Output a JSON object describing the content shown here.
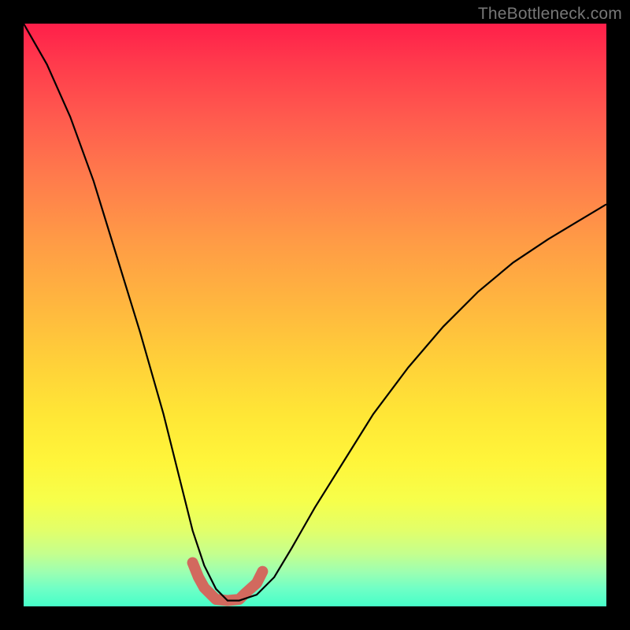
{
  "watermark": {
    "text": "TheBottleneck.com"
  },
  "colors": {
    "frame": "#000000",
    "curve": "#000000",
    "trough_highlight": "#d2695e",
    "gradient_top": "#ff1f4a",
    "gradient_bottom": "#46ffc8"
  },
  "chart_data": {
    "type": "line",
    "title": "",
    "xlabel": "",
    "ylabel": "",
    "xlim": [
      0,
      1
    ],
    "ylim": [
      0,
      1
    ],
    "grid": false,
    "annotations": [
      "TheBottleneck.com"
    ],
    "series": [
      {
        "name": "bottleneck-curve",
        "x": [
          0.0,
          0.04,
          0.08,
          0.12,
          0.16,
          0.2,
          0.24,
          0.27,
          0.29,
          0.31,
          0.33,
          0.35,
          0.37,
          0.4,
          0.43,
          0.46,
          0.5,
          0.55,
          0.6,
          0.66,
          0.72,
          0.78,
          0.84,
          0.9,
          0.95,
          1.0
        ],
        "y": [
          1.0,
          0.93,
          0.84,
          0.73,
          0.6,
          0.47,
          0.33,
          0.21,
          0.13,
          0.07,
          0.03,
          0.01,
          0.01,
          0.02,
          0.05,
          0.1,
          0.17,
          0.25,
          0.33,
          0.41,
          0.48,
          0.54,
          0.59,
          0.63,
          0.66,
          0.69
        ]
      },
      {
        "name": "trough-highlight",
        "x": [
          0.29,
          0.3,
          0.31,
          0.33,
          0.35,
          0.37,
          0.38,
          0.4,
          0.41
        ],
        "y": [
          0.075,
          0.05,
          0.032,
          0.012,
          0.01,
          0.012,
          0.022,
          0.04,
          0.06
        ]
      }
    ]
  }
}
